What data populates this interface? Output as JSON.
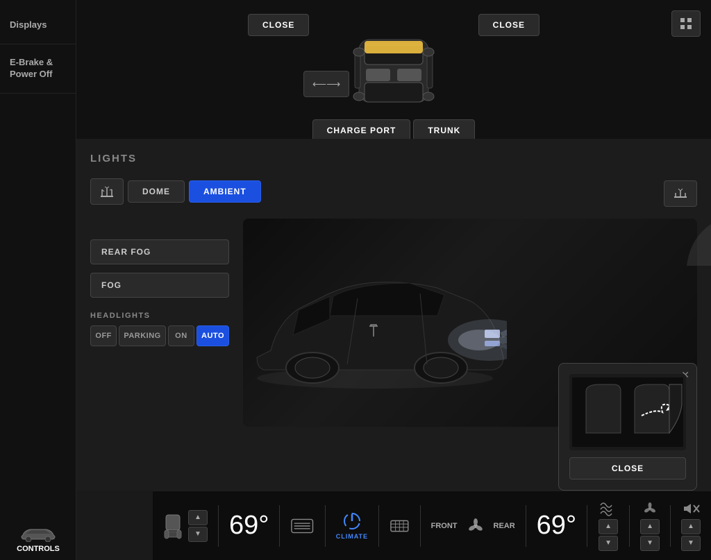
{
  "sidebar": {
    "items": [
      {
        "id": "displays",
        "label": "Displays"
      },
      {
        "id": "ebrake",
        "label": "E-Brake &\nPower Off"
      }
    ],
    "bottom": {
      "controls_label": "CONTROLS"
    }
  },
  "top_area": {
    "close_left_label": "CLOSE",
    "close_right_label": "CLOSE",
    "charge_port_label": "CHARGE PORT",
    "trunk_label": "TRUNK"
  },
  "lights_section": {
    "title": "LIGHTS",
    "buttons": {
      "dome_label": "DOME",
      "ambient_label": "AMBIENT",
      "rear_fog_label": "REAR FOG",
      "fog_label": "FOG"
    },
    "headlights": {
      "label": "HEADLIGHTS",
      "options": [
        {
          "id": "off",
          "label": "OFF",
          "active": false
        },
        {
          "id": "parking",
          "label": "PARKING",
          "active": false
        },
        {
          "id": "on",
          "label": "ON",
          "active": false
        },
        {
          "id": "auto",
          "label": "AUTO",
          "active": true
        }
      ]
    }
  },
  "trunk_popup": {
    "close_label": "CLOSE"
  },
  "bottom_bar": {
    "left_temp": "69°",
    "right_temp": "69°",
    "fan_front_label": "FRONT",
    "fan_rear_label": "REAR",
    "climate_label": "CLIMATE"
  },
  "colors": {
    "accent_blue": "#1a4fe0",
    "active_blue": "#4488ff",
    "bg_dark": "#0d0d0d",
    "bg_medium": "#1a1a1a",
    "text_primary": "#ffffff",
    "text_secondary": "#888888",
    "highlight_yellow": "#f0c040"
  }
}
